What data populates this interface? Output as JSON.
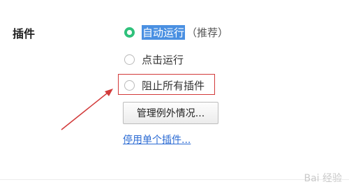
{
  "section": {
    "title": "插件"
  },
  "options": [
    {
      "label": "自动运行",
      "suffix": "（推荐）",
      "checked": true
    },
    {
      "label": "点击运行",
      "suffix": "",
      "checked": false
    },
    {
      "label": "阻止所有插件",
      "suffix": "",
      "checked": false
    }
  ],
  "buttons": {
    "manage_exceptions": "管理例外情况..."
  },
  "links": {
    "disable_individual": "停用单个插件..."
  },
  "watermark": {
    "text": "Bai 经验"
  },
  "colors": {
    "accent_green": "#2fc17b",
    "selection_blue": "#4a90e2",
    "annotation_red": "#d23a3a",
    "link_blue": "#2a6ad3"
  }
}
